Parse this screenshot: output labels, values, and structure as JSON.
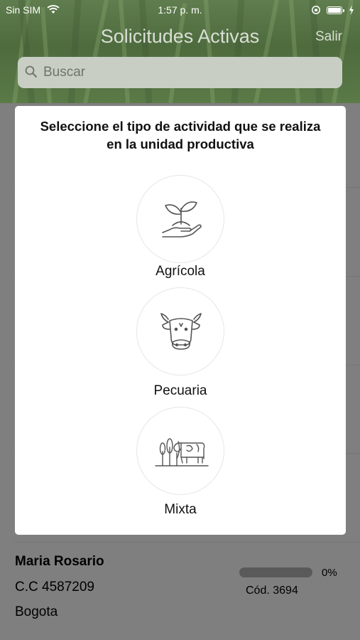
{
  "status_bar": {
    "carrier": "Sin SIM",
    "time": "1:57 p. m."
  },
  "nav": {
    "title": "Solicitudes Activas",
    "logout": "Salir"
  },
  "search": {
    "placeholder": "Buscar"
  },
  "modal": {
    "title_line1": "Seleccione el tipo de actividad que se realiza",
    "title_line2": "en la unidad productiva",
    "options": [
      {
        "label": "Agrícola",
        "icon": "plant-hand-icon"
      },
      {
        "label": "Pecuaria",
        "icon": "cow-head-icon"
      },
      {
        "label": "Mixta",
        "icon": "corn-cow-icon"
      }
    ]
  },
  "request": {
    "name": "Maria Rosario",
    "id": "C.C 4587209",
    "city": "Bogota",
    "progress": 0,
    "progress_label": "0%",
    "code": "Cód. 3694"
  },
  "colors": {
    "overlay": "#7f7f7f",
    "modal_bg": "#ffffff",
    "header_green": "#4e6b3e"
  }
}
